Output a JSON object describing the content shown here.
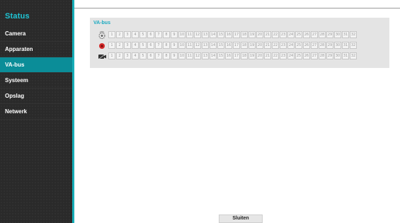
{
  "sidebar": {
    "title": "Status",
    "items": [
      {
        "label": "Camera",
        "active": false
      },
      {
        "label": "Apparaten",
        "active": false
      },
      {
        "label": "VA-bus",
        "active": true
      },
      {
        "label": "Systeem",
        "active": false
      },
      {
        "label": "Opslag",
        "active": false
      },
      {
        "label": "Netwerk",
        "active": false
      }
    ]
  },
  "panel": {
    "title": "VA-bus",
    "rows": [
      {
        "icon": "motion-sensor-icon",
        "channels": [
          "1",
          "2",
          "3",
          "4",
          "5",
          "6",
          "7",
          "8",
          "9",
          "10",
          "11",
          "12",
          "13",
          "14",
          "15",
          "16",
          "17",
          "18",
          "19",
          "20",
          "21",
          "22",
          "23",
          "24",
          "25",
          "26",
          "27",
          "28",
          "29",
          "30",
          "31",
          "32"
        ]
      },
      {
        "icon": "alarm-in-icon",
        "channels": [
          "1",
          "2",
          "3",
          "4",
          "5",
          "6",
          "7",
          "8",
          "9",
          "10",
          "11",
          "12",
          "13",
          "14",
          "15",
          "16",
          "17",
          "18",
          "19",
          "20",
          "21",
          "22",
          "23",
          "24",
          "25",
          "26",
          "27",
          "28",
          "29",
          "30",
          "31",
          "32"
        ]
      },
      {
        "icon": "video-loss-icon",
        "channels": [
          "1",
          "2",
          "3",
          "4",
          "5",
          "6",
          "7",
          "8",
          "9",
          "10",
          "11",
          "12",
          "13",
          "14",
          "15",
          "16",
          "17",
          "18",
          "19",
          "20",
          "21",
          "22",
          "23",
          "24",
          "25",
          "26",
          "27",
          "28",
          "29",
          "30",
          "31",
          "32"
        ]
      }
    ]
  },
  "footer": {
    "close_label": "Sluiten"
  },
  "colors": {
    "accent": "#16aeb8",
    "active_item": "#0b8d98",
    "sidebar_bg": "#2a2a2a",
    "panel_bg": "#e4e4e4"
  }
}
